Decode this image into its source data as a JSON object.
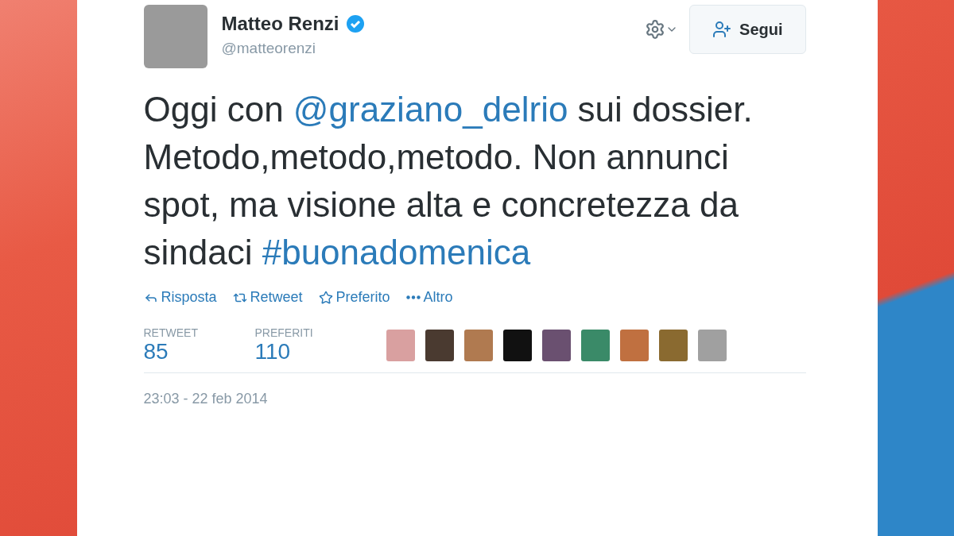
{
  "author": {
    "name": "Matteo Renzi",
    "verified": true,
    "handle": "@matteorenzi"
  },
  "follow_button": {
    "label": "Segui"
  },
  "tweet": [
    {
      "kind": "text",
      "text": "Oggi con "
    },
    {
      "kind": "link",
      "text": "@graziano_delrio"
    },
    {
      "kind": "text",
      "text": " sui dossier. Metodo,metodo,metodo. Non annunci spot, ma visione alta e concretezza da sindaci "
    },
    {
      "kind": "link",
      "text": "#buonadomenica"
    }
  ],
  "actions": [
    {
      "kind": "reply",
      "label": "Risposta"
    },
    {
      "kind": "retweet",
      "label": "Retweet"
    },
    {
      "kind": "favorite",
      "label": "Preferito"
    },
    {
      "kind": "more",
      "label": "Altro"
    }
  ],
  "stats": [
    {
      "label": "RETWEET",
      "value": "85"
    },
    {
      "label": "PREFERITI",
      "value": "110"
    }
  ],
  "favoriters": [
    {
      "color": "#d9a0a0"
    },
    {
      "color": "#4a3a30"
    },
    {
      "color": "#b07a50"
    },
    {
      "color": "#111111"
    },
    {
      "color": "#6a5070"
    },
    {
      "color": "#3a8a68"
    },
    {
      "color": "#c07040"
    },
    {
      "color": "#8a6a30"
    },
    {
      "color": "#a0a0a0"
    }
  ],
  "timestamp": "23:03 - 22 feb 2014"
}
